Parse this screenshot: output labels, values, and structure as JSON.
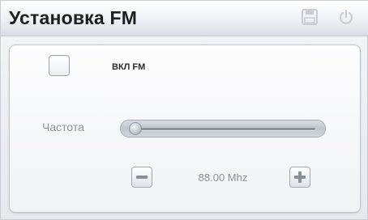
{
  "window": {
    "title": "Установка FM",
    "icons": {
      "save": "save-icon",
      "power": "power-icon"
    }
  },
  "fm": {
    "toggle_label": "ВКЛ FM",
    "enabled": false
  },
  "frequency": {
    "label": "Частота",
    "value_text": "88.00 Mhz",
    "value_mhz": 88.0,
    "slider_fraction": 0.0
  },
  "controls": {
    "decrease_icon": "minus-icon",
    "increase_icon": "plus-icon"
  },
  "colors": {
    "title_text": "#1e1e1e",
    "muted_text": "#8e939b",
    "icon_grey": "#8b9097"
  }
}
